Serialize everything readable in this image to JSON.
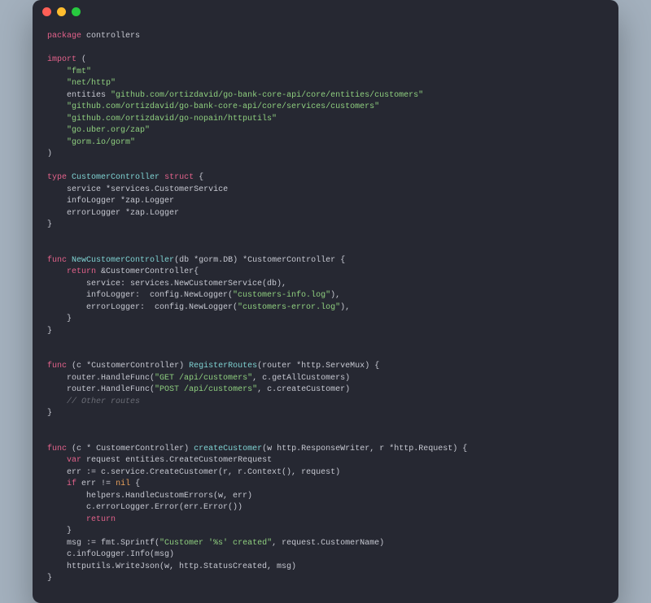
{
  "window": {
    "traffic_lights": {
      "red": "close",
      "yellow": "minimize",
      "green": "zoom"
    }
  },
  "code": {
    "pkg_kw": "package",
    "pkg_name": "controllers",
    "import_kw": "import",
    "imp_fmt": "\"fmt\"",
    "imp_http": "\"net/http\"",
    "imp_entities_alias": "entities",
    "imp_entities": "\"github.com/ortizdavid/go-bank-core-api/core/entities/customers\"",
    "imp_services": "\"github.com/ortizdavid/go-bank-core-api/core/services/customers\"",
    "imp_httputils": "\"github.com/ortizdavid/go-nopain/httputils\"",
    "imp_zap": "\"go.uber.org/zap\"",
    "imp_gorm": "\"gorm.io/gorm\"",
    "lparen": "(",
    "rparen": ")",
    "type_kw": "type",
    "struct_kw": "struct",
    "cc_name": "CustomerController",
    "lbrace": "{",
    "rbrace": "}",
    "field_service": "service",
    "field_service_type": "*services.CustomerService",
    "field_info": "infoLogger",
    "field_err": "errorLogger",
    "zap_type": "*zap.Logger",
    "func_kw": "func",
    "new_cc": "NewCustomerController",
    "db_param": "db",
    "gorm_type": "*gorm.DB",
    "ret_type": "*CustomerController",
    "return_kw": "return",
    "amp_cc": "&CustomerController",
    "svc_init": "service: services.NewCustomerService(db),",
    "info_init_l": "infoLogger:  config.NewLogger(",
    "info_log": "\"customers-info.log\"",
    "err_init_l": "errorLogger:  config.NewLogger(",
    "err_log": "\"customers-error.log\"",
    "close_call": "),",
    "recv_c": "c",
    "recv_type": "*CustomerController",
    "reg_routes": "RegisterRoutes",
    "router_param": "router",
    "servemux_type": "*http.ServeMux",
    "hf1_l": "router.HandleFunc(",
    "route_get": "\"GET /api/customers\"",
    "hf1_r": ", c.getAllCustomers)",
    "hf2_l": "router.HandleFunc(",
    "route_post": "\"POST /api/customers\"",
    "hf2_r": ", c.createCustomer)",
    "other_routes": "// Other routes",
    "recv_type2": "* CustomerController",
    "create_cust": "createCustomer",
    "w_param": "w",
    "rw_type": "http.ResponseWriter",
    "r_param": "r",
    "req_type": "*http.Request",
    "var_kw": "var",
    "request_var": "request",
    "req_entity": "entities.CreateCustomerRequest",
    "err_assign": "err := c.service.CreateCustomer(r, r.Context(), request)",
    "if_kw": "if",
    "cond": "err !=",
    "nil_kw": "nil",
    "handle_err": "helpers.HandleCustomErrors(w, err)",
    "log_err": "c.errorLogger.Error(err.Error())",
    "msg_l": "msg := fmt.Sprintf(",
    "msg_str": "\"Customer '%s' created\"",
    "msg_r": ", request.CustomerName)",
    "info_log_call": "c.infoLogger.Info(msg)",
    "write_json": "httputils.WriteJson(w, http.StatusCreated, msg)"
  }
}
